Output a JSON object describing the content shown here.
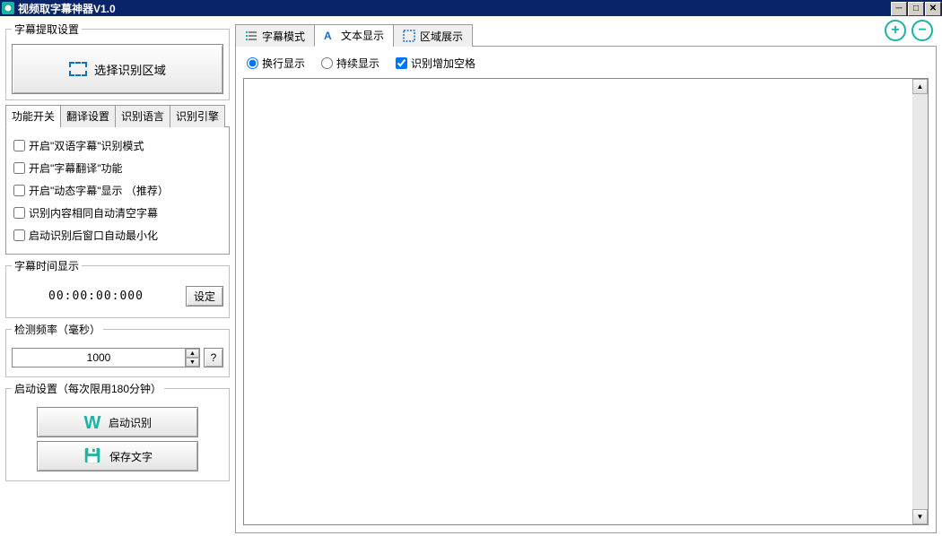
{
  "window": {
    "title": "视频取字幕神器V1.0"
  },
  "left": {
    "extract": {
      "legend": "字幕提取设置",
      "select_region_label": "选择识别区域"
    },
    "tabs": {
      "t1": "功能开关",
      "t2": "翻译设置",
      "t3": "识别语言",
      "t4": "识别引擎"
    },
    "checks": {
      "c1": "开启\"双语字幕\"识别模式",
      "c2": "开启\"字幕翻译\"功能",
      "c3": "开启\"动态字幕\"显示 （推荐）",
      "c4": "识别内容相同自动清空字幕",
      "c5": "启动识别后窗口自动最小化"
    },
    "time": {
      "legend": "字幕时间显示",
      "value": "00:00:00:000",
      "set_btn": "设定"
    },
    "freq": {
      "legend": "检测频率（毫秒）",
      "value": "1000",
      "help": "?"
    },
    "start": {
      "legend": "启动设置（每次限用180分钟）",
      "recognize": "启动识别",
      "save": "保存文字"
    }
  },
  "right": {
    "tabs": {
      "subtitle_mode": "字幕模式",
      "text_display": "文本显示",
      "region_display": "区域展示"
    },
    "radios": {
      "wrap_display": "换行显示",
      "continue_display": "持续显示",
      "add_space": "识别增加空格"
    },
    "plus": "+",
    "minus": "−"
  }
}
